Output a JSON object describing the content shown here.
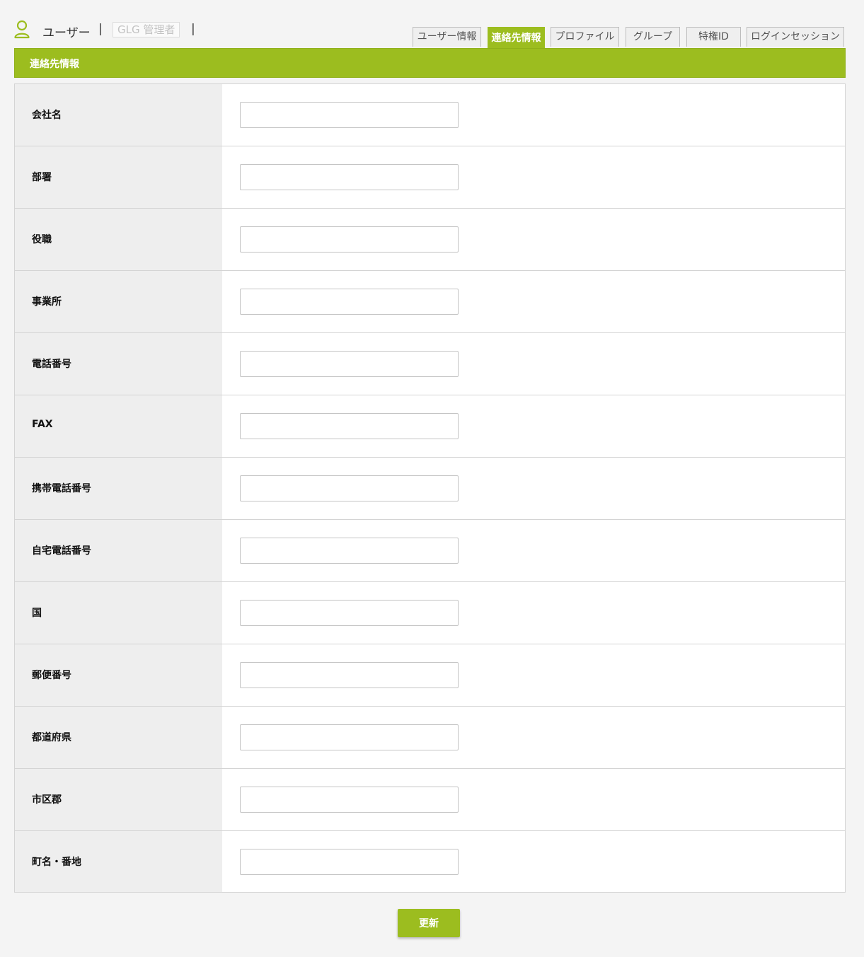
{
  "header": {
    "title": "ユーザー",
    "separator": "|",
    "user_name": "GLG 管理者"
  },
  "tabs": [
    {
      "label": "ユーザー情報",
      "active": false
    },
    {
      "label": "連絡先情報",
      "active": true
    },
    {
      "label": "プロファイル",
      "active": false
    },
    {
      "label": "グループ",
      "active": false
    },
    {
      "label": "特権ID",
      "active": false
    },
    {
      "label": "ログインセッション",
      "active": false
    }
  ],
  "section": {
    "title": "連絡先情報"
  },
  "fields": [
    {
      "label": "会社名",
      "value": ""
    },
    {
      "label": "部署",
      "value": ""
    },
    {
      "label": "役職",
      "value": ""
    },
    {
      "label": "事業所",
      "value": ""
    },
    {
      "label": "電話番号",
      "value": ""
    },
    {
      "label": "FAX",
      "value": ""
    },
    {
      "label": "携帯電話番号",
      "value": ""
    },
    {
      "label": "自宅電話番号",
      "value": ""
    },
    {
      "label": "国",
      "value": ""
    },
    {
      "label": "郵便番号",
      "value": ""
    },
    {
      "label": "都道府県",
      "value": ""
    },
    {
      "label": "市区郡",
      "value": ""
    },
    {
      "label": "町名・番地",
      "value": ""
    }
  ],
  "actions": {
    "submit_label": "更新"
  },
  "colors": {
    "accent": "#9cbd1f",
    "label_bg": "#eeeeee",
    "page_bg": "#f4f4f4"
  },
  "icons": {
    "header_icon": "user-icon"
  }
}
